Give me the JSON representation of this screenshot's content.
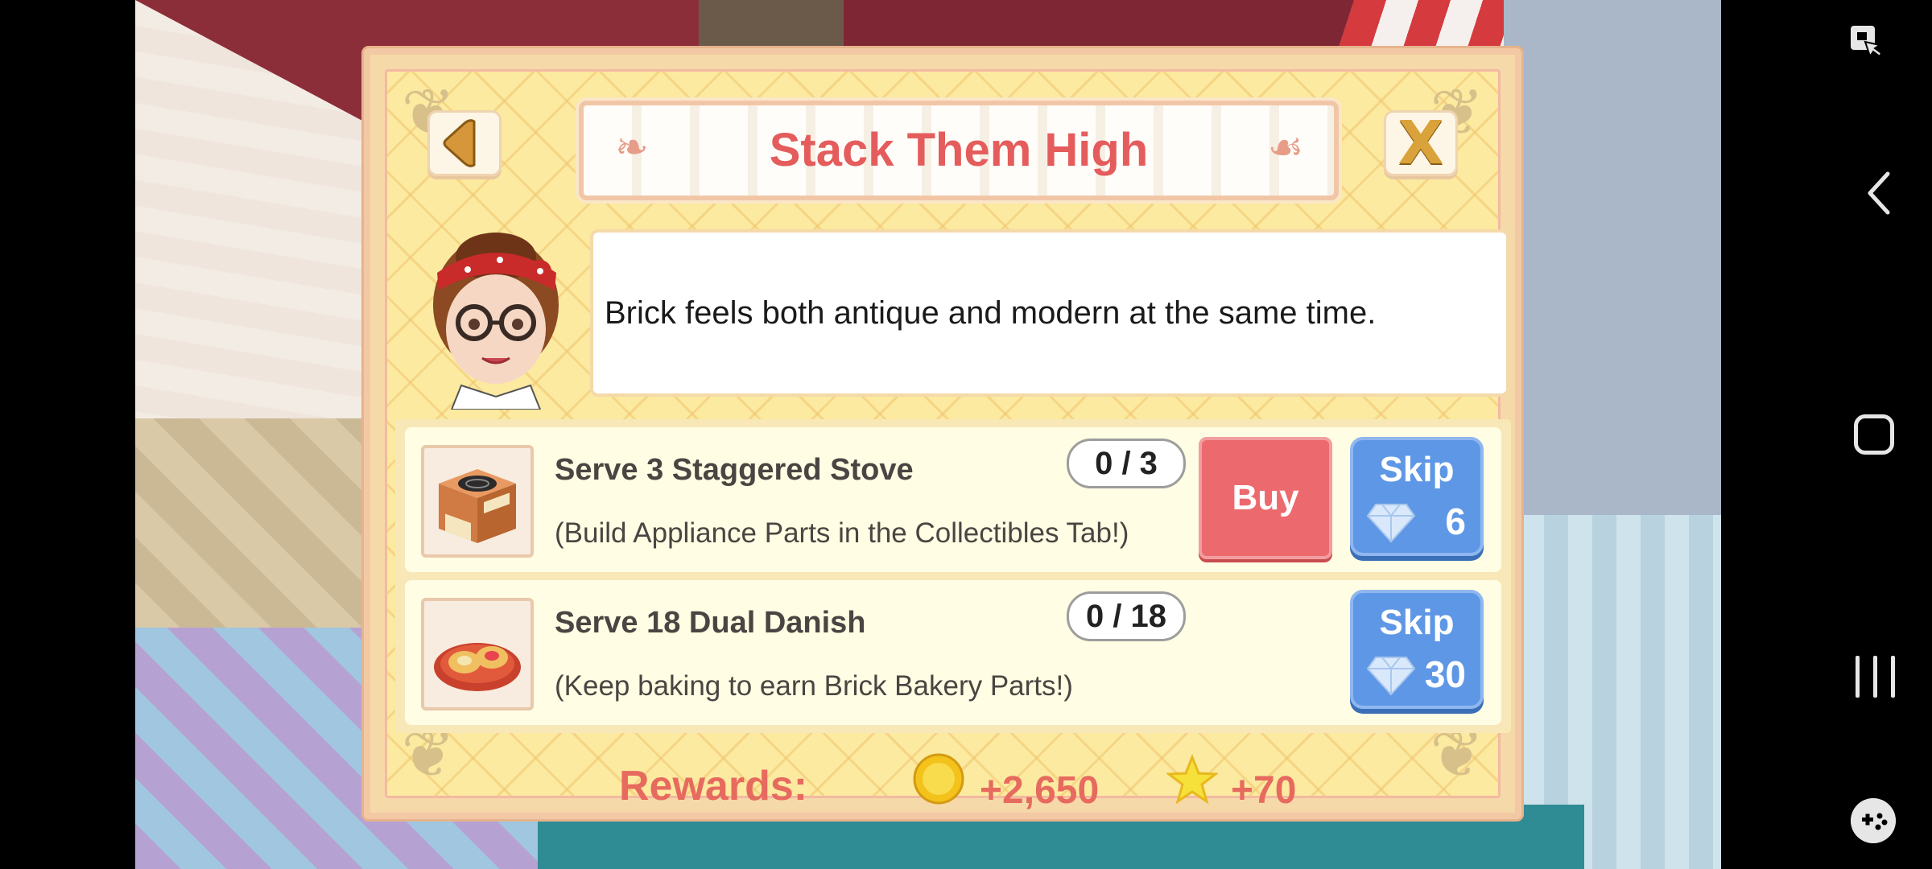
{
  "dialog": {
    "title": "Stack Them High",
    "message": "Brick feels both antique and modern at the same time.",
    "close_label": "X"
  },
  "tasks": [
    {
      "title": "Serve 3 Staggered Stove",
      "hint": "(Build Appliance Parts in the Collectibles Tab!)",
      "progress": "0 / 3",
      "buy_label": "Buy",
      "skip_label": "Skip",
      "skip_cost": "6",
      "icon": "stove-icon"
    },
    {
      "title": "Serve 18 Dual Danish",
      "hint": "(Keep baking to earn Brick Bakery Parts!)",
      "progress": "0 / 18",
      "skip_label": "Skip",
      "skip_cost": "30",
      "icon": "danish-icon"
    }
  ],
  "rewards": {
    "label": "Rewards:",
    "coins": "+2,650",
    "stars": "+70"
  },
  "colors": {
    "title": "#e45c5c",
    "buy": "#ec6a6d",
    "skip": "#5e97e6",
    "reward_text": "#e76a5f",
    "panel": "#fbeaa0"
  }
}
